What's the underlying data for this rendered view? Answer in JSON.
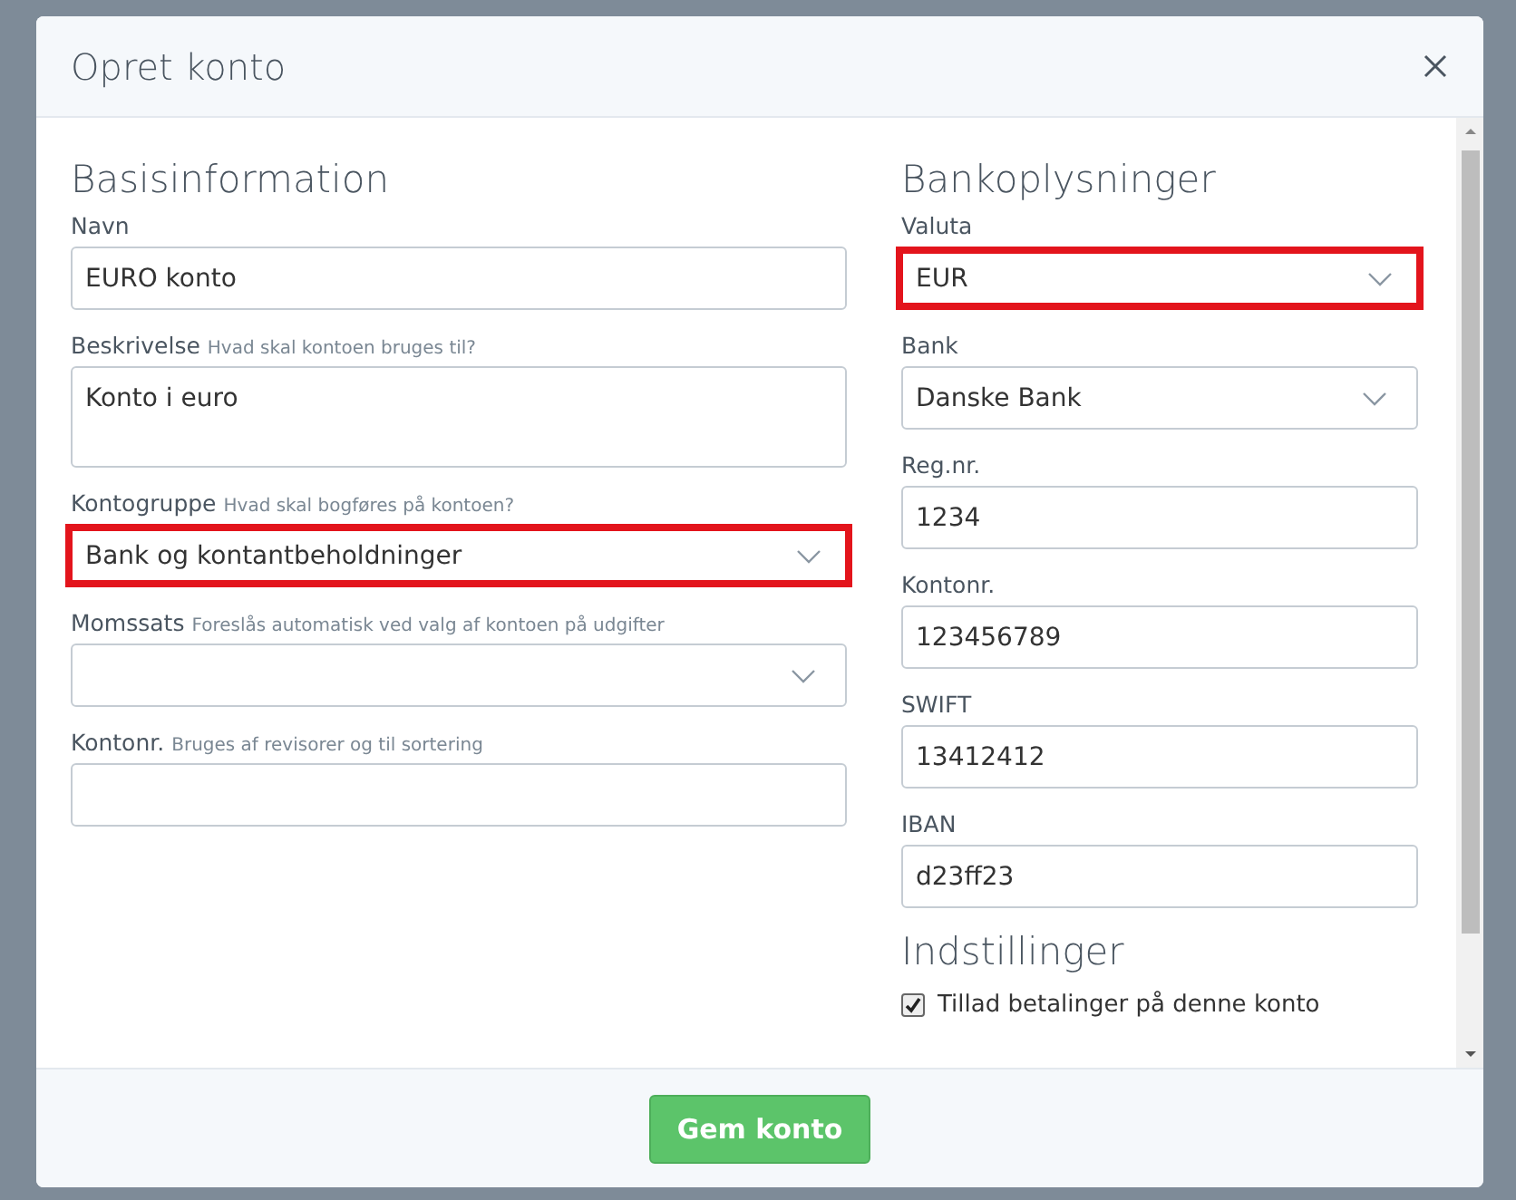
{
  "dialog": {
    "title": "Opret konto"
  },
  "sections": [
    {
      "title": "Basisinformation",
      "fields": [
        {
          "kind": "text",
          "label": "Navn",
          "value": "EURO konto",
          "highlighted": false
        },
        {
          "kind": "textarea",
          "label": "Beskrivelse",
          "hint": "Hvad skal kontoen bruges til?",
          "value": "Konto i euro",
          "highlighted": false
        },
        {
          "kind": "select",
          "label": "Kontogruppe",
          "hint": "Hvad skal bogføres på kontoen?",
          "value": "Bank og kontantbeholdninger",
          "highlighted": true
        },
        {
          "kind": "select",
          "label": "Momssats",
          "hint": "Foreslås automatisk ved valg af kontoen på udgifter",
          "highlighted": false
        },
        {
          "kind": "text",
          "label": "Kontonr.",
          "hint": "Bruges af revisorer og til sortering",
          "highlighted": false
        }
      ]
    },
    {
      "title": "Bankoplysninger",
      "fields": [
        {
          "kind": "select",
          "label": "Valuta",
          "value": "EUR",
          "highlighted": true
        },
        {
          "kind": "select",
          "label": "Bank",
          "value": "Danske Bank",
          "highlighted": false
        },
        {
          "kind": "text",
          "label": "Reg.nr.",
          "value": "1234",
          "highlighted": false
        },
        {
          "kind": "text",
          "label": "Kontonr.",
          "value": "123456789",
          "highlighted": false
        },
        {
          "kind": "text",
          "label": "SWIFT",
          "value": "13412412",
          "highlighted": false
        },
        {
          "kind": "text",
          "label": "IBAN",
          "value": "d23ff23",
          "highlighted": false
        }
      ]
    }
  ],
  "settings": {
    "title": "Indstillinger",
    "options": [
      {
        "label": "Tillad betalinger på denne konto",
        "checked": true
      }
    ]
  },
  "save_button": "Gem konto"
}
